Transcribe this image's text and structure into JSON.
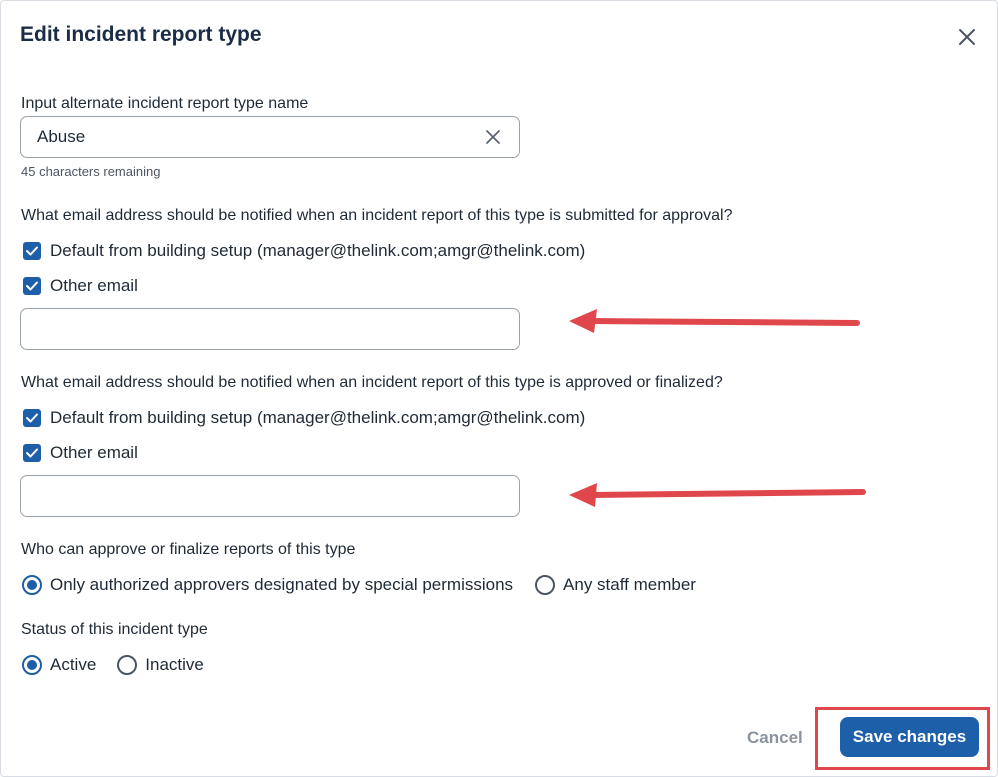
{
  "dialog": {
    "title": "Edit incident report type"
  },
  "name_field": {
    "label": "Input alternate incident report type name",
    "value": "Abuse",
    "hint": "45 characters remaining"
  },
  "submitted_section": {
    "question": "What email address should be notified when an incident report of this type is submitted for approval?",
    "default_label": "Default from building setup (manager@thelink.com;amgr@thelink.com)",
    "default_checked": true,
    "other_label": "Other email",
    "other_checked": true,
    "other_value": ""
  },
  "approved_section": {
    "question": "What email address should be notified when an incident report of this type is approved or finalized?",
    "default_label": "Default from building setup (manager@thelink.com;amgr@thelink.com)",
    "default_checked": true,
    "other_label": "Other email",
    "other_checked": true,
    "other_value": ""
  },
  "approver_section": {
    "question": "Who can approve or finalize reports of this type",
    "options": [
      {
        "label": "Only authorized approvers designated by special permissions",
        "selected": true
      },
      {
        "label": "Any staff member",
        "selected": false
      }
    ]
  },
  "status_section": {
    "question": "Status of this incident type",
    "options": [
      {
        "label": "Active",
        "selected": true
      },
      {
        "label": "Inactive",
        "selected": false
      }
    ]
  },
  "footer": {
    "cancel_label": "Cancel",
    "save_label": "Save changes"
  },
  "colors": {
    "primary": "#1d5fa8",
    "annotation_red": "#e0474c"
  }
}
